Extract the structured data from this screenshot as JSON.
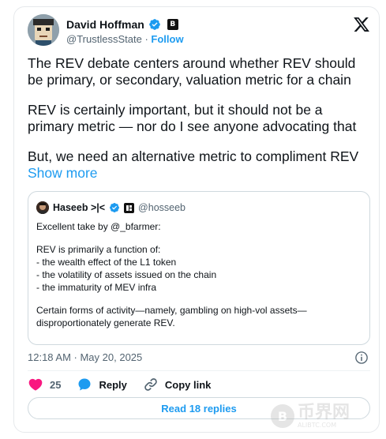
{
  "author": {
    "name": "David Hoffman",
    "handle": "@TrustlessState",
    "separator": "·",
    "follow_label": "Follow",
    "badge_letter": "B"
  },
  "post": {
    "paragraphs": [
      "The REV debate centers around whether REV should be primary, or secondary, valuation metric for a chain",
      "REV is certainly important, but it should not be a primary metric — nor do I see anyone advocating that"
    ],
    "last_paragraph": "But, we need an alternative metric to compliment REV",
    "show_more_label": "Show more"
  },
  "quote": {
    "name": "Haseeb >|<",
    "handle": "@hosseeb",
    "paragraphs": [
      "Excellent take by @_bfarmer:",
      "REV is primarily a function of:\n- the wealth effect of the L1 token\n- the volatility of assets issued on the chain\n- the immaturity of MEV infra",
      "Certain forms of activity—namely, gambling on high-vol assets—disproportionately generate REV."
    ]
  },
  "timestamp": "12:18 AM · May 20, 2025",
  "actions": {
    "likes_count": "25",
    "reply_label": "Reply",
    "copy_link_label": "Copy link"
  },
  "read_replies_label": "Read 18 replies",
  "watermark": {
    "text": "币界网",
    "sub": "ALIBTC.COM",
    "coin_letter": "B"
  },
  "colors": {
    "accent": "#1d9bf0",
    "like": "#f91880",
    "text": "#0f1419",
    "muted": "#536471"
  }
}
